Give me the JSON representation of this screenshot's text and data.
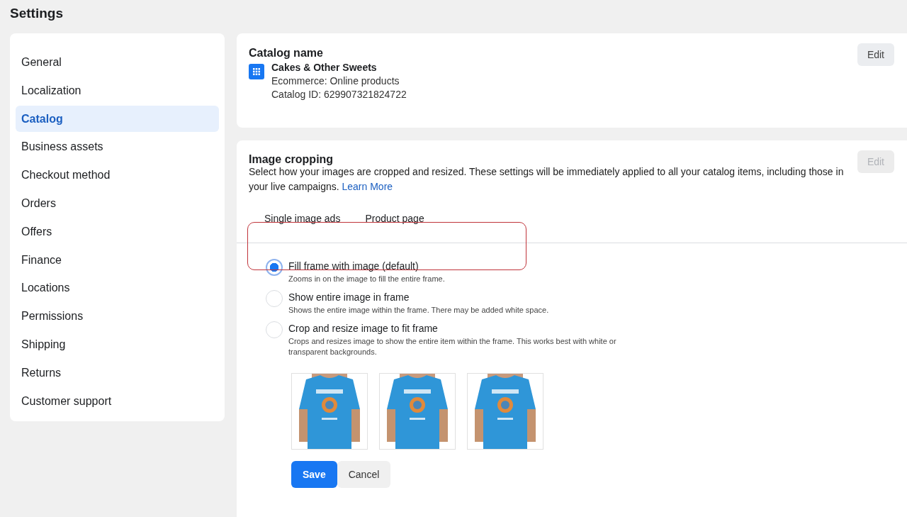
{
  "page_title": "Settings",
  "sidebar": {
    "items": [
      {
        "label": "General",
        "selected": false
      },
      {
        "label": "Localization",
        "selected": false
      },
      {
        "label": "Catalog",
        "selected": true
      },
      {
        "label": "Business assets",
        "selected": false
      },
      {
        "label": "Checkout method",
        "selected": false
      },
      {
        "label": "Orders",
        "selected": false
      },
      {
        "label": "Offers",
        "selected": false
      },
      {
        "label": "Finance",
        "selected": false
      },
      {
        "label": "Locations",
        "selected": false
      },
      {
        "label": "Permissions",
        "selected": false
      },
      {
        "label": "Shipping",
        "selected": false
      },
      {
        "label": "Returns",
        "selected": false
      },
      {
        "label": "Customer support",
        "selected": false
      }
    ]
  },
  "catalog_card": {
    "title": "Catalog name",
    "edit_button": {
      "label": "Edit",
      "disabled": false
    },
    "name": "Cakes & Other Sweets",
    "type": "Ecommerce: Online products",
    "catalog_id": "Catalog ID: 629907321824722"
  },
  "cropping_card": {
    "title": "Image cropping",
    "edit_button": {
      "label": "Edit",
      "disabled": true
    },
    "description": "Select how your images are cropped and resized. These settings will be immediately applied to all your catalog items, including those in your live campaigns.",
    "link": "Learn More",
    "tabs": [
      {
        "label": "Single image ads"
      },
      {
        "label": "Product page"
      }
    ],
    "options": [
      {
        "label": "Fill frame with image (default)",
        "hint": "Zooms in on the image to fill the entire frame.",
        "selected": true
      },
      {
        "label": "Show entire image in frame",
        "hint": "Shows the entire image within the frame. There may be added white space.",
        "selected": false
      },
      {
        "label": "Crop and resize image to fit frame",
        "hint": "Crops and resizes image to show the entire item within the frame. This works best with white or transparent backgrounds.",
        "selected": false
      }
    ],
    "buttons": [
      {
        "label": "Save",
        "kind": "primary"
      },
      {
        "label": "Cancel",
        "kind": "secondary"
      }
    ]
  }
}
